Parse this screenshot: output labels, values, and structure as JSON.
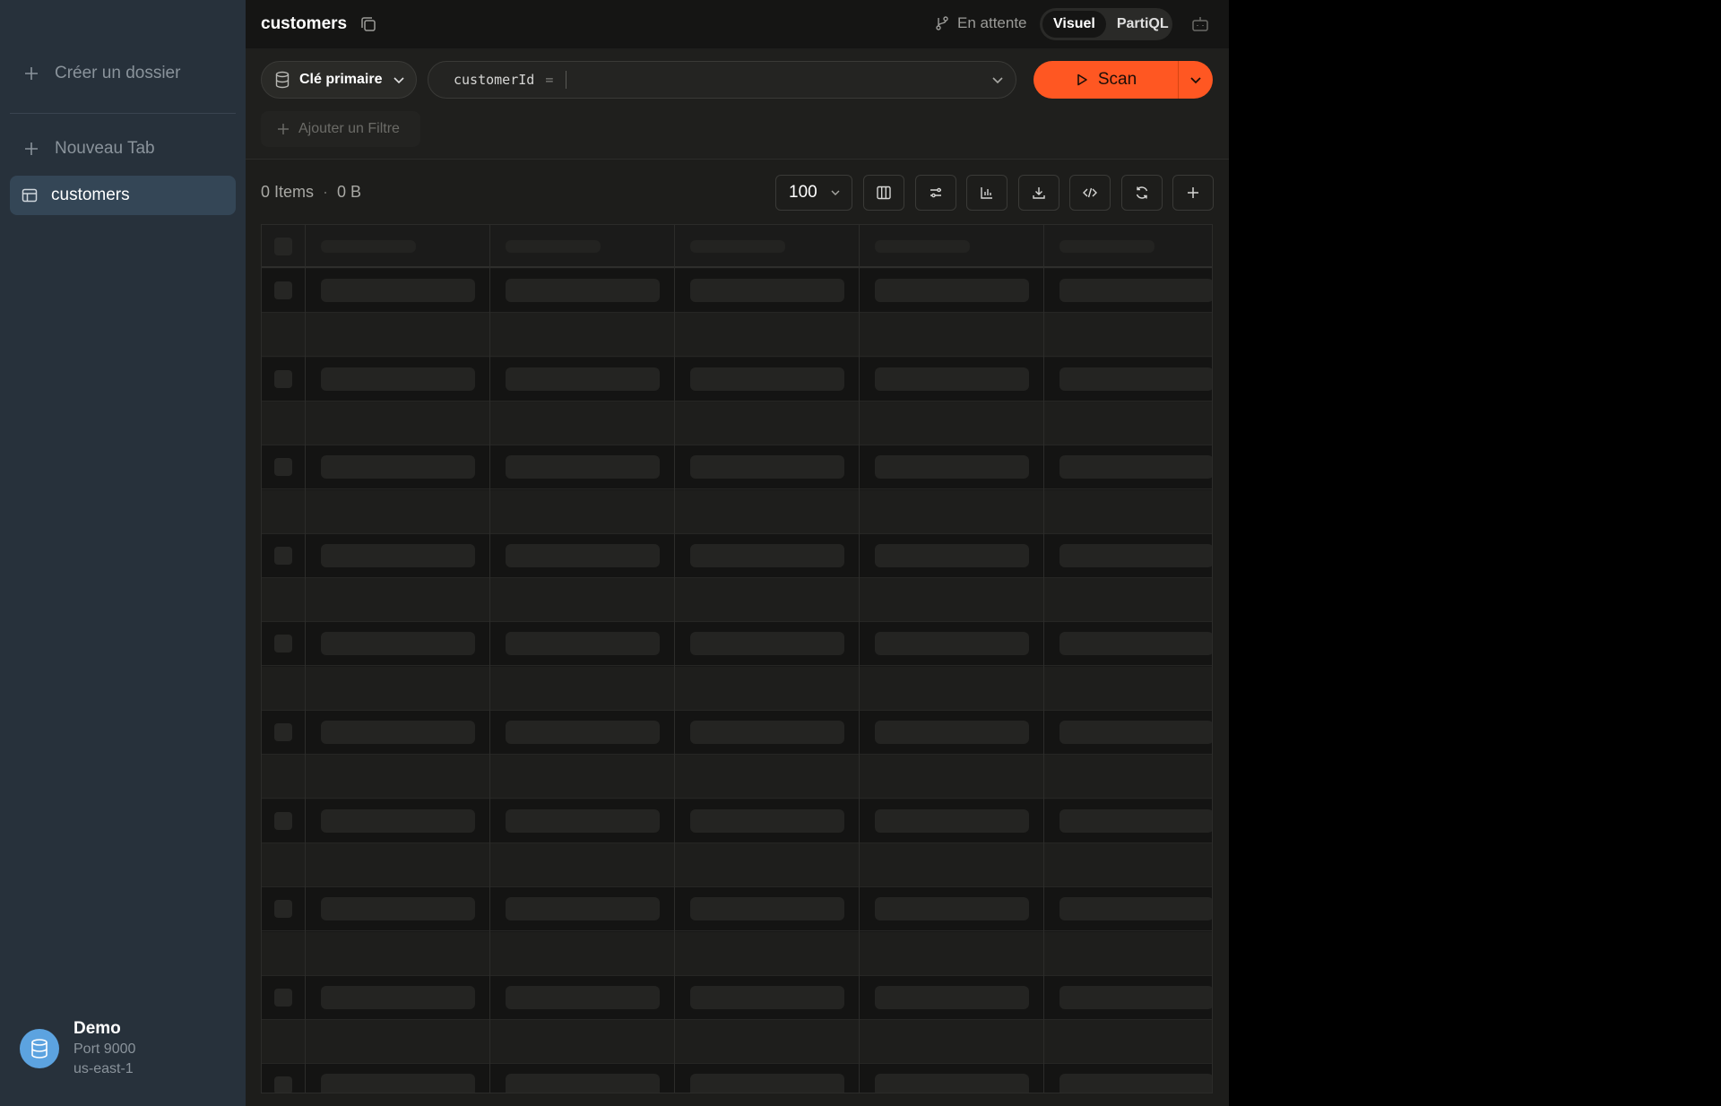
{
  "sidebar": {
    "create_folder": "Créer un dossier",
    "new_tab": "Nouveau Tab",
    "tables": [
      {
        "label": "customers"
      }
    ],
    "connection": {
      "name": "Demo",
      "port": "Port 9000",
      "region": "us-east-1"
    }
  },
  "header": {
    "title": "customers",
    "status": "En attente",
    "modes": [
      "Visuel",
      "PartiQL"
    ],
    "active_mode": "Visuel"
  },
  "query": {
    "index_label": "Clé primaire",
    "key_name": "customerId",
    "operator": "=",
    "key_value": "",
    "scan_label": "Scan",
    "add_filter_label": "Ajouter un Filtre"
  },
  "results": {
    "items": "0 Items",
    "size": "0 B",
    "limit": "100",
    "state": "loading-skeleton"
  },
  "colors": {
    "accent": "#ff5722",
    "sidebar_bg": "#27313b",
    "main_bg": "#1d1d1b",
    "avatar": "#5ca3e0"
  }
}
